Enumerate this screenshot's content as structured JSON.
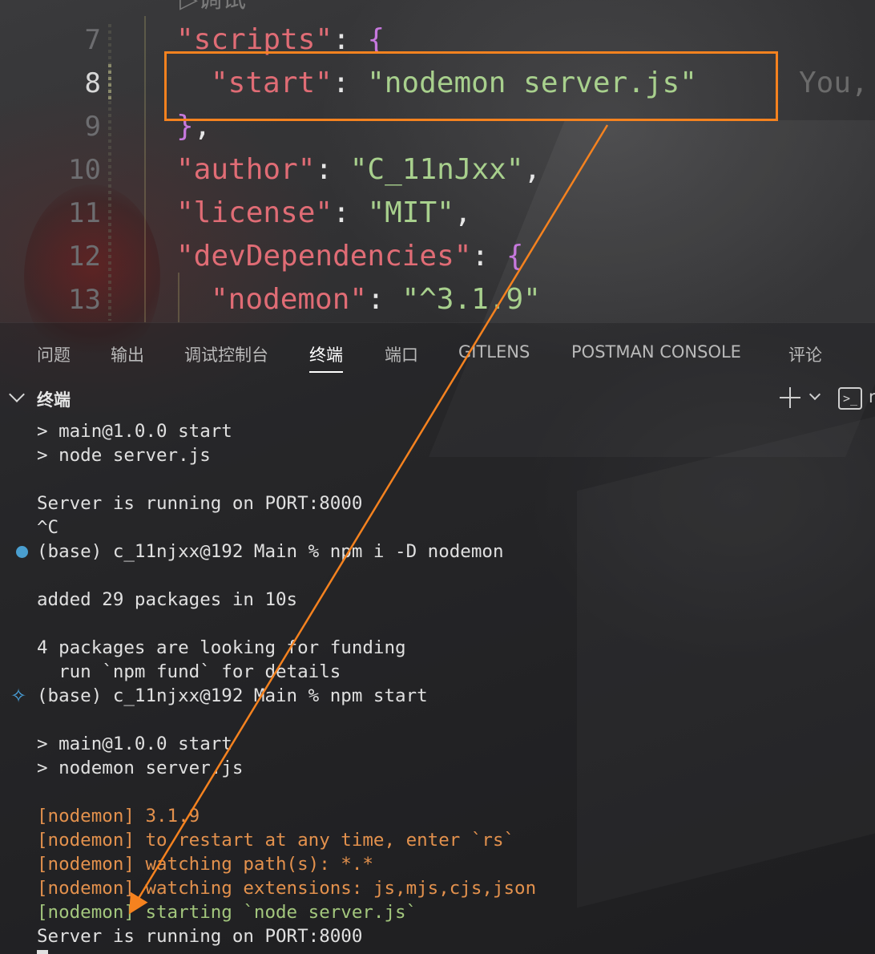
{
  "editor": {
    "cut_top_text": "▷调试",
    "lines": [
      {
        "num": "7",
        "key": "\"scripts\"",
        "rest": ": ",
        "brace": "{"
      },
      {
        "num": "8",
        "key": "\"start\"",
        "rest": ": ",
        "value": "\"nodemon server.js\"",
        "blame": "You,"
      },
      {
        "num": "9",
        "brace": "}",
        "rest": ","
      },
      {
        "num": "10",
        "key": "\"author\"",
        "rest": ": ",
        "value": "\"C_11nJxx\"",
        "tail": ","
      },
      {
        "num": "11",
        "key": "\"license\"",
        "rest": ": ",
        "value": "\"MIT\"",
        "tail": ","
      },
      {
        "num": "12",
        "key": "\"devDependencies\"",
        "rest": ": ",
        "brace": "{"
      },
      {
        "num": "13",
        "key": "\"nodemon\"",
        "rest": ": ",
        "value": "\"^3.1.9\""
      }
    ]
  },
  "panel": {
    "tabs": [
      "问题",
      "输出",
      "调试控制台",
      "终端",
      "端口",
      "GITLENS",
      "POSTMAN CONSOLE",
      "评论"
    ],
    "active_tab": "终端",
    "section_title": "终端",
    "terminal_icon_glyph": ">_",
    "cut_right_char": "r"
  },
  "terminal": {
    "lines": [
      "> main@1.0.0 start",
      "> node server.js",
      "",
      "Server is running on PORT:8000",
      "^C",
      "(base) c_11njxx@192 Main % npm i -D nodemon",
      "",
      "added 29 packages in 10s",
      "",
      "4 packages are looking for funding",
      "  run `npm fund` for details",
      "(base) c_11njxx@192 Main % npm start",
      "",
      "> main@1.0.0 start",
      "> nodemon server.js",
      "",
      "[nodemon] 3.1.9",
      "[nodemon] to restart at any time, enter `rs`",
      "[nodemon] watching path(s): *.*",
      "[nodemon] watching extensions: js,mjs,cjs,json",
      "[nodemon] starting `node server.js`",
      "Server is running on PORT:8000"
    ]
  },
  "colors": {
    "accent_orange": "#f5821f",
    "json_key": "#e06c75",
    "json_string": "#a8d08d",
    "nodemon_yellow": "#e3914d",
    "nodemon_green": "#a3c77d"
  }
}
